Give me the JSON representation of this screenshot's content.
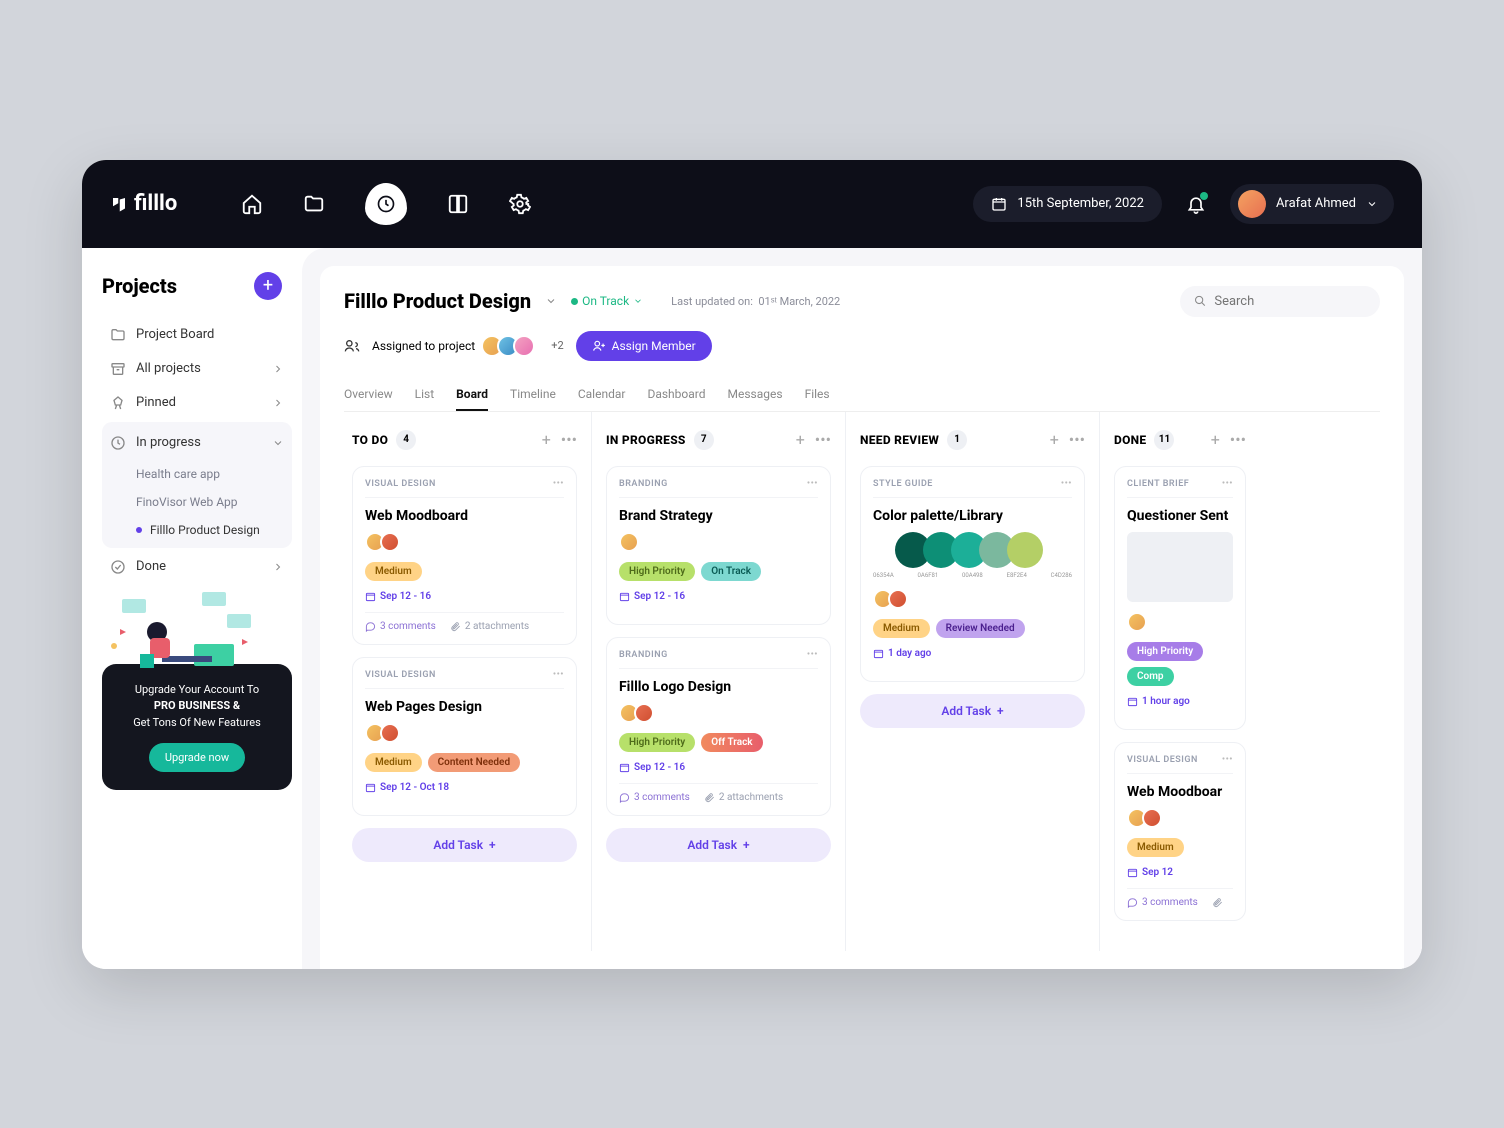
{
  "brand": "filllo",
  "topbar": {
    "date": "15th September, 2022",
    "user_name": "Arafat Ahmed"
  },
  "sidebar": {
    "title": "Projects",
    "items": [
      {
        "icon": "folder",
        "label": "Project Board"
      },
      {
        "icon": "archive",
        "label": "All projects",
        "chev": true
      },
      {
        "icon": "pin",
        "label": "Pinned",
        "chev": true
      }
    ],
    "progress_label": "In progress",
    "progress_items": [
      "Health care app",
      "FinoVisor Web App",
      "Filllo Product Design"
    ],
    "done_label": "Done"
  },
  "upgrade": {
    "text1": "Upgrade Your Account To",
    "text2": "PRO BUSINESS &",
    "text3": "Get Tons Of New Features",
    "button": "Upgrade now"
  },
  "project": {
    "title": "Filllo Product Design",
    "status": "On Track",
    "last_updated_label": "Last updated on:",
    "last_updated_value": "01ˢᵗ  March, 2022",
    "assigned_label": "Assigned to project",
    "more_count": "+2",
    "assign_button": "Assign Member",
    "search_placeholder": "Search"
  },
  "tabs": [
    "Overview",
    "List",
    "Board",
    "Timeline",
    "Calendar",
    "Dashboard",
    "Messages",
    "Files"
  ],
  "active_tab": "Board",
  "columns": [
    {
      "name": "TO DO",
      "count": "4",
      "cards": [
        {
          "cat": "VISUAL DESIGN",
          "title": "Web Moodboard",
          "avs": 2,
          "pills": [
            {
              "t": "Medium",
              "c": "medium"
            }
          ],
          "date": "Sep 12 - 16",
          "comments": "3 comments",
          "attach": "2 attachments"
        },
        {
          "cat": "VISUAL DESIGN",
          "title": "Web Pages Design",
          "avs": 2,
          "pills": [
            {
              "t": "Medium",
              "c": "medium"
            },
            {
              "t": "Content Needed",
              "c": "content"
            }
          ],
          "date": "Sep 12 - Oct 18"
        }
      ],
      "addTask": true
    },
    {
      "name": "IN PROGRESS",
      "count": "7",
      "cards": [
        {
          "cat": "BRANDING",
          "title": "Brand Strategy",
          "avs": 1,
          "pills": [
            {
              "t": "High Priority",
              "c": "high"
            },
            {
              "t": "On Track",
              "c": "ontrack"
            }
          ],
          "date": "Sep 12 - 16"
        },
        {
          "cat": "BRANDING",
          "title": "Filllo Logo Design",
          "avs": 2,
          "pills": [
            {
              "t": "High Priority",
              "c": "high"
            },
            {
              "t": "Off Track",
              "c": "offtrack"
            }
          ],
          "date": "Sep 12 - 16",
          "comments": "3 comments",
          "attach": "2 attachments"
        }
      ],
      "addTask": true
    },
    {
      "name": "NEED REVIEW",
      "count": "1",
      "cards": [
        {
          "cat": "STYLE GUIDE",
          "title": "Color palette/Library",
          "palette": true,
          "avs": 2,
          "pills": [
            {
              "t": "Medium",
              "c": "medium"
            },
            {
              "t": "Review Needed",
              "c": "review"
            }
          ],
          "date": "1 day ago"
        }
      ],
      "addTask": true
    },
    {
      "name": "DONE",
      "count": "11",
      "cards": [
        {
          "cat": "CLIENT BRIEF",
          "title": "Questioner Sent",
          "imgph": true,
          "avs": 1,
          "pills": [
            {
              "t": "High Priority",
              "c": "hp-purple"
            },
            {
              "t": "Comp",
              "c": "comp"
            }
          ],
          "date": "1 hour ago"
        },
        {
          "cat": "VISUAL DESIGN",
          "title": "Web Moodboar",
          "avs": 2,
          "pills": [
            {
              "t": "Medium",
              "c": "medium"
            }
          ],
          "date": "Sep 12",
          "comments": "3 comments",
          "attach": ""
        }
      ]
    }
  ],
  "palette_colors": [
    "#065a4b",
    "#0d8f76",
    "#1caf98",
    "#7bb89e",
    "#b4cf66"
  ],
  "palette_labels": [
    "06354A",
    "0A6F81",
    "00A498",
    "E8F2E4",
    "C4D286"
  ],
  "add_task_label": "Add Task"
}
